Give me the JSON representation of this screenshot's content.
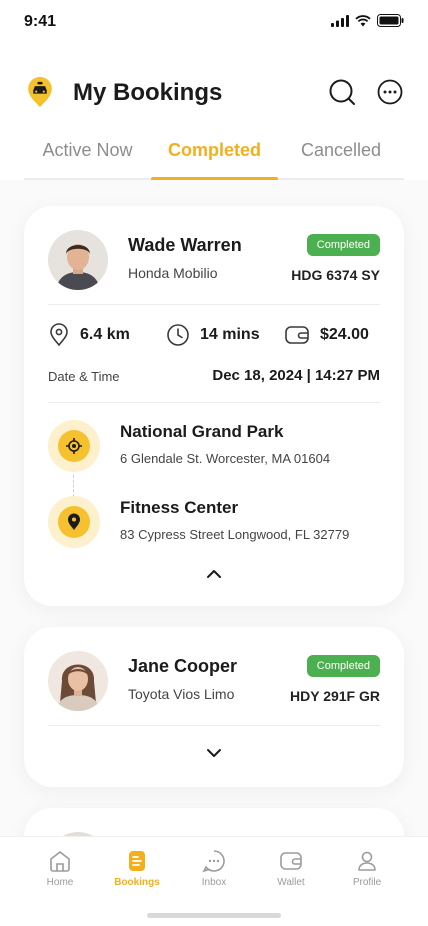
{
  "status_bar": {
    "time": "9:41"
  },
  "header": {
    "title": "My Bookings"
  },
  "tabs": [
    {
      "label": "Active Now"
    },
    {
      "label": "Completed"
    },
    {
      "label": "Cancelled"
    }
  ],
  "bookings": [
    {
      "driver": "Wade Warren",
      "car": "Honda Mobilio",
      "status": "Completed",
      "plate": "HDG 6374 SY",
      "distance": "6.4 km",
      "duration": "14 mins",
      "price": "$24.00",
      "datetime_label": "Date & Time",
      "datetime": "Dec 18, 2024 | 14:27 PM",
      "pickup_name": "National Grand Park",
      "pickup_address": "6 Glendale St. Worcester, MA 01604",
      "dropoff_name": "Fitness Center",
      "dropoff_address": "83 Cypress Street Longwood, FL 32779"
    },
    {
      "driver": "Jane Cooper",
      "car": "Toyota Vios Limo",
      "status": "Completed",
      "plate": "HDY 291F GR"
    }
  ],
  "nav": [
    {
      "label": "Home",
      "icon": "home-icon"
    },
    {
      "label": "Bookings",
      "icon": "bookings-icon",
      "active": true
    },
    {
      "label": "Inbox",
      "icon": "inbox-icon"
    },
    {
      "label": "Wallet",
      "icon": "wallet-icon"
    },
    {
      "label": "Profile",
      "icon": "profile-icon"
    }
  ],
  "colors": {
    "accent": "#f2b01e",
    "badge": "#4caf50",
    "location": "#f6c12e"
  }
}
